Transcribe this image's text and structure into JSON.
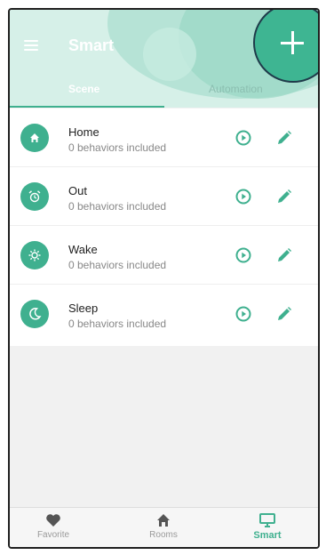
{
  "header": {
    "title": "Smart"
  },
  "tabs": [
    {
      "label": "Scene",
      "active": true
    },
    {
      "label": "Automation",
      "active": false
    }
  ],
  "scenes": [
    {
      "name": "Home",
      "subtitle": "0 behaviors included",
      "icon": "home-icon"
    },
    {
      "name": "Out",
      "subtitle": "0 behaviors included",
      "icon": "alarm-clock-icon"
    },
    {
      "name": "Wake",
      "subtitle": "0 behaviors included",
      "icon": "sun-gear-icon"
    },
    {
      "name": "Sleep",
      "subtitle": "0 behaviors included",
      "icon": "moon-icon"
    }
  ],
  "bottom_nav": [
    {
      "label": "Favorite",
      "icon": "heart-icon",
      "active": false
    },
    {
      "label": "Rooms",
      "icon": "house-icon",
      "active": false
    },
    {
      "label": "Smart",
      "icon": "monitor-icon",
      "active": true
    }
  ],
  "colors": {
    "accent": "#3fb08f",
    "header_bg": "#d6f0e8",
    "fab": "#3eb592"
  }
}
